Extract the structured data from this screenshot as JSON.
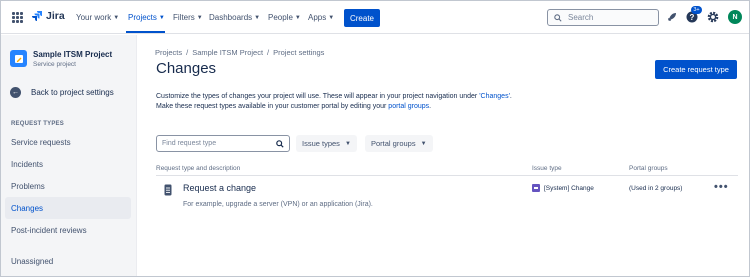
{
  "topnav": {
    "logo_text": "Jira",
    "items": [
      {
        "label": "Your work"
      },
      {
        "label": "Projects"
      },
      {
        "label": "Filters"
      },
      {
        "label": "Dashboards"
      },
      {
        "label": "People"
      },
      {
        "label": "Apps"
      }
    ],
    "create_label": "Create",
    "search_placeholder": "Search",
    "notification_badge": "3+",
    "avatar_initial": "N",
    "accent_color": "#0052cc"
  },
  "sidebar": {
    "project_name": "Sample ITSM Project",
    "project_type": "Service project",
    "back_label": "Back to project settings",
    "section_title": "REQUEST TYPES",
    "items": [
      {
        "label": "Service requests"
      },
      {
        "label": "Incidents"
      },
      {
        "label": "Problems"
      },
      {
        "label": "Changes"
      },
      {
        "label": "Post-incident reviews"
      }
    ],
    "unassigned_label": "Unassigned"
  },
  "main": {
    "breadcrumb": [
      "Projects",
      "Sample ITSM Project",
      "Project settings"
    ],
    "title": "Changes",
    "create_request_type_label": "Create request type",
    "description": {
      "line1_text": "Customize the types of changes your project will use. These will appear in your project navigation under ",
      "line1_link": "'Changes'",
      "line1_end": ".",
      "line2_text": "Make these request types available in your customer portal by editing your ",
      "line2_link": "portal groups",
      "line2_end": "."
    },
    "filter_placeholder": "Find request type",
    "issue_types_label": "Issue types",
    "portal_groups_label": "Portal groups",
    "table": {
      "headers": [
        "Request type and description",
        "Issue type",
        "Portal groups"
      ],
      "rows": [
        {
          "title": "Request a change",
          "description": "For example, upgrade a server (VPN) or an application (Jira).",
          "issue_type": "[System] Change",
          "portal_groups": "(Used in 2 groups)",
          "actions": "•••"
        }
      ]
    }
  }
}
